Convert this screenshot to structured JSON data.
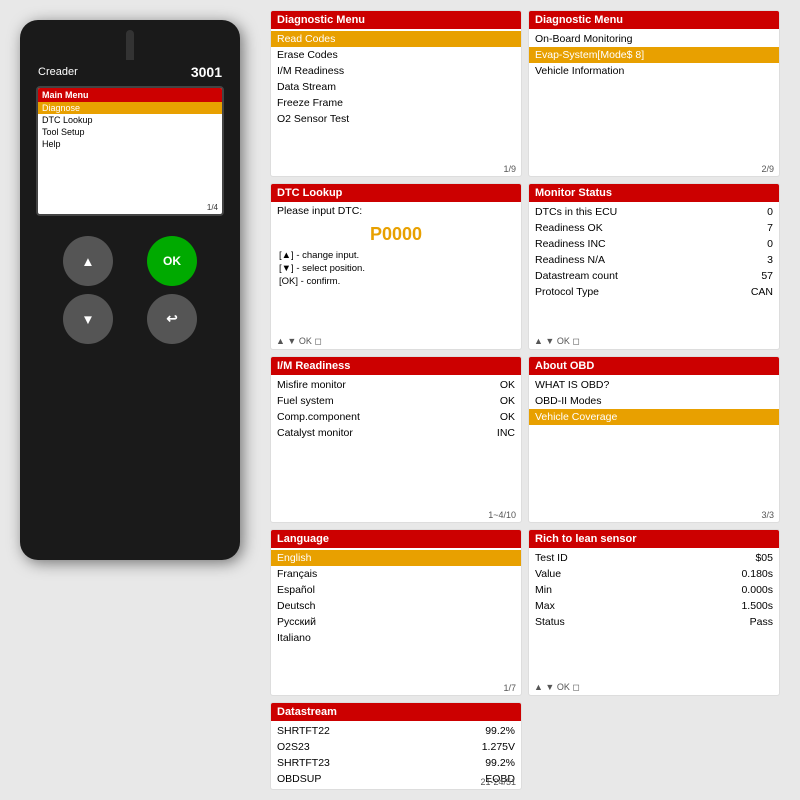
{
  "device": {
    "brand": "Creader",
    "model": "3001",
    "screen": {
      "header": "Main Menu",
      "items": [
        {
          "label": "Diagnose",
          "active": true
        },
        {
          "label": "DTC Lookup",
          "active": false
        },
        {
          "label": "Tool Setup",
          "active": false
        },
        {
          "label": "Help",
          "active": false
        }
      ],
      "page": "1/4"
    }
  },
  "panels": {
    "diagnostic_menu_1": {
      "header": "Diagnostic Menu",
      "items": [
        {
          "label": "Read Codes",
          "highlighted": true
        },
        {
          "label": "Erase Codes",
          "highlighted": false
        },
        {
          "label": "I/M Readiness",
          "highlighted": false
        },
        {
          "label": "Data Stream",
          "highlighted": false
        },
        {
          "label": "Freeze Frame",
          "highlighted": false
        },
        {
          "label": "O2 Sensor Test",
          "highlighted": false
        }
      ],
      "page": "1/9"
    },
    "diagnostic_menu_2": {
      "header": "Diagnostic Menu",
      "items": [
        {
          "label": "On-Board Monitoring",
          "highlighted": false
        },
        {
          "label": "Evap-System[Mode$ 8]",
          "highlighted": true
        },
        {
          "label": "Vehicle Information",
          "highlighted": false
        }
      ],
      "page": "2/9"
    },
    "dtc_lookup": {
      "header": "DTC Lookup",
      "prompt": "Please input DTC:",
      "code": "P0000",
      "instructions": [
        "[▲] - change input.",
        "[▼] - select position.",
        "[OK] - confirm."
      ]
    },
    "monitor_status": {
      "header": "Monitor Status",
      "rows": [
        {
          "label": "DTCs in this ECU",
          "value": "0"
        },
        {
          "label": "Readiness OK",
          "value": "7"
        },
        {
          "label": "Readiness INC",
          "value": "0"
        },
        {
          "label": "Readiness N/A",
          "value": "3"
        },
        {
          "label": "Datastream count",
          "value": "57"
        },
        {
          "label": "Protocol Type",
          "value": "CAN"
        }
      ]
    },
    "im_readiness": {
      "header": "I/M Readiness",
      "rows": [
        {
          "label": "Misfire monitor",
          "value": "OK"
        },
        {
          "label": "Fuel system",
          "value": "OK"
        },
        {
          "label": "Comp.component",
          "value": "OK"
        },
        {
          "label": "Catalyst monitor",
          "value": "INC"
        }
      ],
      "page": "1~4/10"
    },
    "about_obd": {
      "header": "About OBD",
      "items": [
        {
          "label": "WHAT IS OBD?",
          "highlighted": false
        },
        {
          "label": "OBD-II Modes",
          "highlighted": false
        },
        {
          "label": "Vehicle Coverage",
          "highlighted": true
        }
      ],
      "page": "3/3"
    },
    "language": {
      "header": "Language",
      "items": [
        {
          "label": "English",
          "highlighted": true
        },
        {
          "label": "Français",
          "highlighted": false
        },
        {
          "label": "Español",
          "highlighted": false
        },
        {
          "label": "Deutsch",
          "highlighted": false
        },
        {
          "label": "Русский",
          "highlighted": false
        },
        {
          "label": "Italiano",
          "highlighted": false
        }
      ],
      "page": "1/7"
    },
    "datastream": {
      "header": "Datastream",
      "rows": [
        {
          "label": "SHRTFT22",
          "value": "99.2%"
        },
        {
          "label": "O2S23",
          "value": "1.275V"
        },
        {
          "label": "SHRTFT23",
          "value": "99.2%"
        },
        {
          "label": "OBDSUP",
          "value": "EOBD"
        }
      ],
      "page": "21-24/51"
    },
    "rich_to_lean": {
      "header": "Rich to lean sensor",
      "rows": [
        {
          "label": "Test ID",
          "value": "$05"
        },
        {
          "label": "Value",
          "value": "0.180s"
        },
        {
          "label": "Min",
          "value": "0.000s"
        },
        {
          "label": "Max",
          "value": "1.500s"
        },
        {
          "label": "Status",
          "value": "Pass"
        }
      ]
    }
  },
  "colors": {
    "header_red": "#cc0000",
    "highlight_orange": "#e8a000",
    "text_dark": "#000000",
    "bg_white": "#ffffff"
  }
}
